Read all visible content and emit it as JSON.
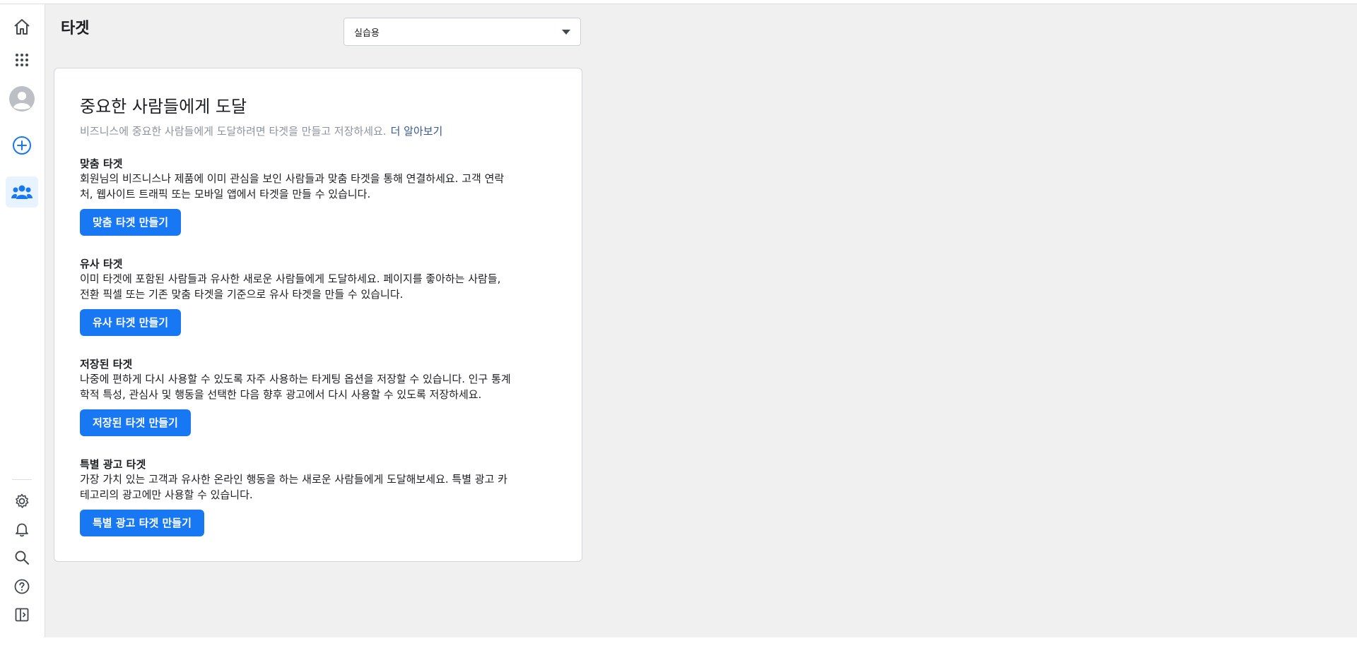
{
  "page": {
    "title": "타겟"
  },
  "account_selector": {
    "value": "실습용"
  },
  "sidebar": {
    "items": [
      {
        "name": "home-icon"
      },
      {
        "name": "all-tools-icon"
      },
      {
        "name": "avatar"
      },
      {
        "name": "create-icon"
      },
      {
        "name": "audiences-icon",
        "active": true
      }
    ],
    "bottom_items": [
      {
        "name": "settings-icon"
      },
      {
        "name": "notifications-icon"
      },
      {
        "name": "search-icon"
      },
      {
        "name": "help-icon"
      },
      {
        "name": "collapse-panel-icon"
      }
    ]
  },
  "card": {
    "title": "중요한 사람들에게 도달",
    "subtitle": "비즈니스에 중요한 사람들에게 도달하려면 타겟을 만들고 저장하세요.",
    "learn_more": "더 알아보기",
    "sections": [
      {
        "heading": "맞춤 타겟",
        "line1": "회원님의 비즈니스나 제품에 이미 관심을 보인 사람들과 맞춤 타겟을 통해 연결하세요. 고객 연락",
        "line2": "처, 웹사이트 트래픽 또는 모바일 앱에서 타겟을 만들 수 있습니다.",
        "button": "맞춤 타겟 만들기"
      },
      {
        "heading": "유사 타겟",
        "line1": "이미 타겟에 포함된 사람들과 유사한 새로운 사람들에게 도달하세요. 페이지를 좋아하는 사람들,",
        "line2": "전환 픽셀 또는 기존 맞춤 타겟을 기준으로 유사 타겟을 만들 수 있습니다.",
        "button": "유사 타겟 만들기"
      },
      {
        "heading": "저장된 타겟",
        "line1": "나중에 편하게 다시 사용할 수 있도록 자주 사용하는 타게팅 옵션을 저장할 수 있습니다. 인구 통계",
        "line2": "학적 특성, 관심사 및 행동을 선택한 다음 향후 광고에서 다시 사용할 수 있도록 저장하세요.",
        "button": "저장된 타겟 만들기"
      },
      {
        "heading": "특별 광고 타겟",
        "line1": "가장 가치 있는 고객과 유사한 온라인 행동을 하는 새로운 사람들에게 도달해보세요. 특별 광고 카",
        "line2": "테고리의 광고에만 사용할 수 있습니다.",
        "button": "특별 광고 타겟 만들기"
      }
    ]
  },
  "colors": {
    "accent": "#1877f2",
    "link": "#385898",
    "active_nav_bg": "#e7f3ff",
    "content_bg": "#f0f0f0"
  }
}
